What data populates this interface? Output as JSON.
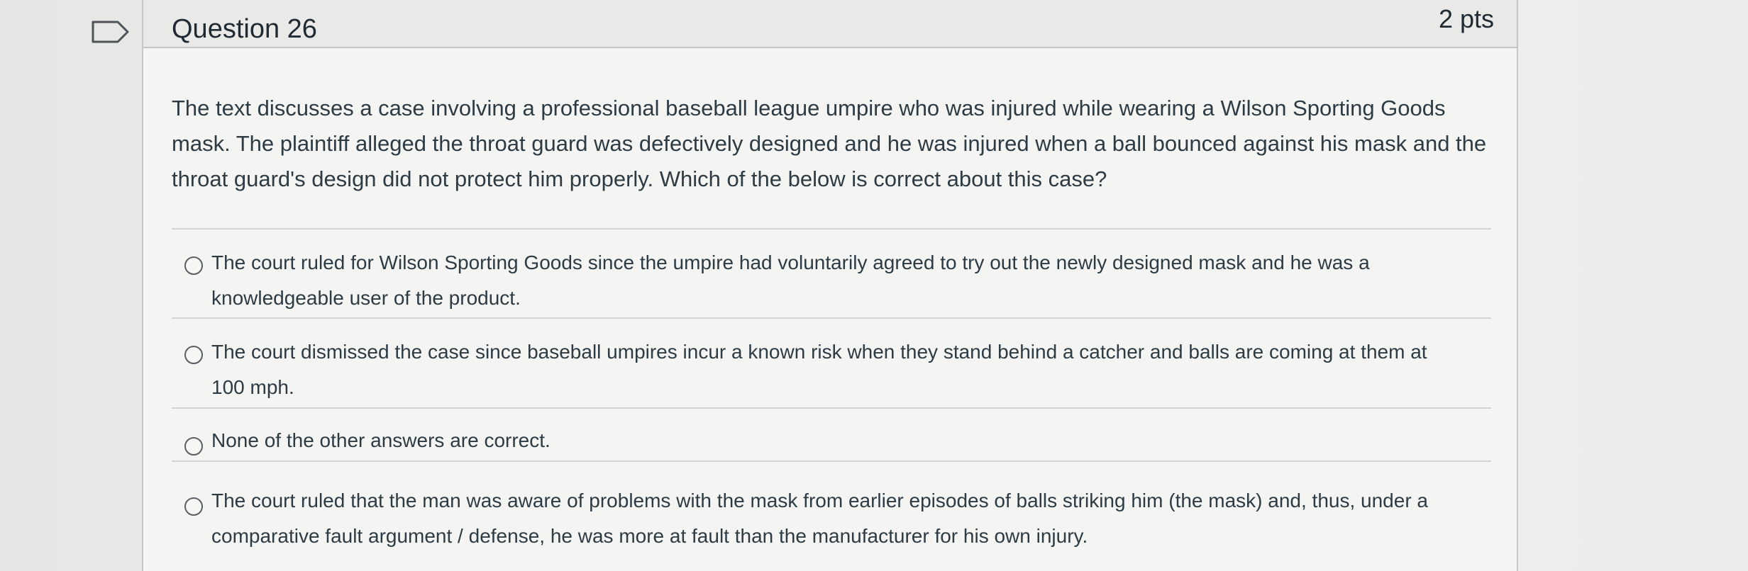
{
  "question": {
    "title": "Question 26",
    "points": "2 pts",
    "text": "The text discusses a case involving a professional baseball league umpire who was injured while wearing a Wilson Sporting Goods mask. The plaintiff alleged the throat guard was defectively designed and he was injured when a ball bounced against his mask and the throat guard's design did not protect him properly.  Which of the below is correct about this case?"
  },
  "answers": [
    {
      "label": "The court ruled for Wilson Sporting Goods since the umpire had voluntarily agreed to try out the newly designed mask and he was a knowledgeable user of the product."
    },
    {
      "label": "The court dismissed the case since baseball umpires incur a known risk when they stand behind a catcher and balls are coming at them at 100 mph."
    },
    {
      "label": "None of the other answers are correct."
    },
    {
      "label": "The court ruled that the man was aware of problems with the mask from earlier episodes of balls striking him (the mask) and, thus, under a comparative fault argument / defense, he was more at fault than the manufacturer for his own injury."
    }
  ],
  "icons": {
    "flag": "flag-question-icon",
    "radio": "radio-unselected-icon"
  },
  "colors": {
    "text": "#2d3b45",
    "header_bg": "#e9e9e7",
    "card_bg": "#f4f4f2"
  }
}
